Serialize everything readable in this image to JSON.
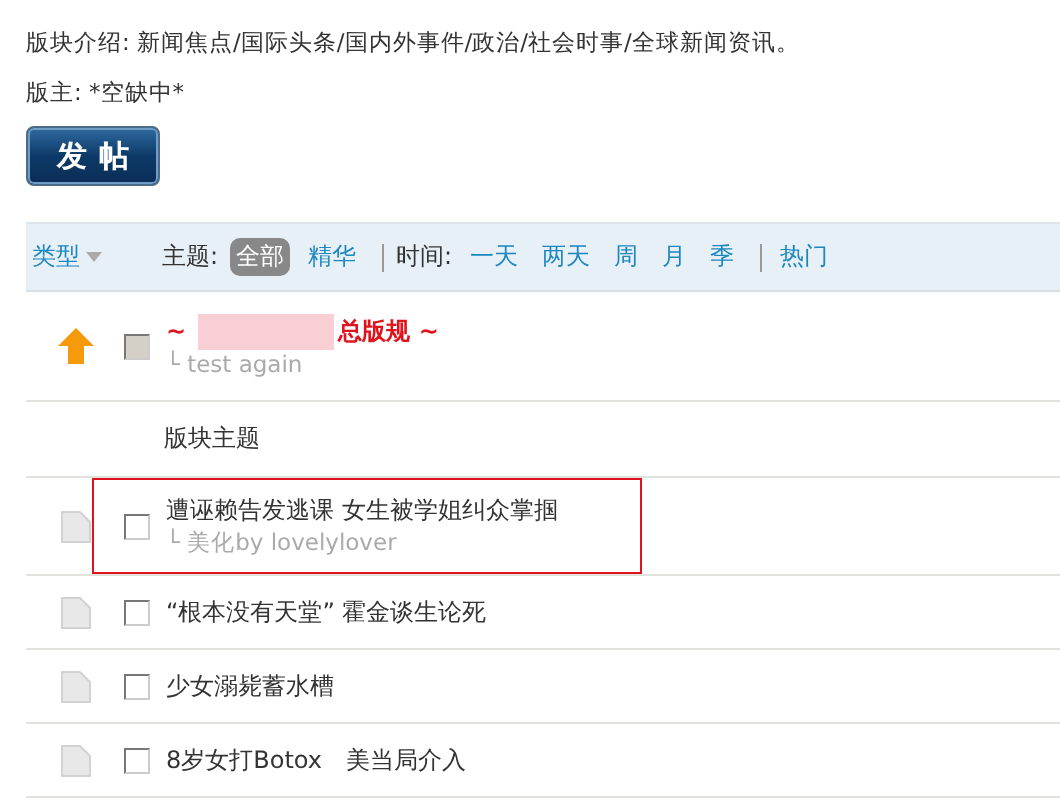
{
  "forum_info": {
    "description": "版块介绍: 新闻焦点/国际头条/国内外事件/政治/社会时事/全球新闻资讯。",
    "moderator": "版主: *空缺中*"
  },
  "post_button": "发帖",
  "filter_bar": {
    "type_label": "类型",
    "groups": [
      {
        "label": "主题:",
        "options": [
          {
            "label": "全部",
            "selected": true
          },
          {
            "label": "精华",
            "selected": false
          }
        ]
      },
      {
        "label": "时间:",
        "options": [
          {
            "label": "一天",
            "selected": false
          },
          {
            "label": "两天",
            "selected": false
          },
          {
            "label": "周",
            "selected": false
          },
          {
            "label": "月",
            "selected": false
          },
          {
            "label": "季",
            "selected": false
          }
        ]
      },
      {
        "options": [
          {
            "label": "热门",
            "selected": false
          }
        ]
      }
    ]
  },
  "pinned_threads": [
    {
      "kind": "pinned",
      "title_start": "~",
      "title_end": "总版规 ~",
      "redacted": true,
      "subtitle": "└ test again",
      "checked": false,
      "disabled": true,
      "highlighted": false
    }
  ],
  "section_title": "版块主题",
  "threads": [
    {
      "kind": "normal",
      "title": "遭诬赖告发逃课 女生被学姐纠众掌掴",
      "subtitle": "└ 美化by lovelylover",
      "checked": false,
      "disabled": false,
      "highlighted": true
    },
    {
      "kind": "normal",
      "title": "“根本没有天堂” 霍金谈生论死",
      "checked": false,
      "disabled": false,
      "highlighted": false
    },
    {
      "kind": "normal",
      "title": "少女溺毙蓄水槽",
      "checked": false,
      "disabled": false,
      "highlighted": false
    },
    {
      "kind": "normal",
      "title": "8岁女打Botox　美当局介入",
      "checked": false,
      "disabled": false,
      "highlighted": false
    }
  ]
}
